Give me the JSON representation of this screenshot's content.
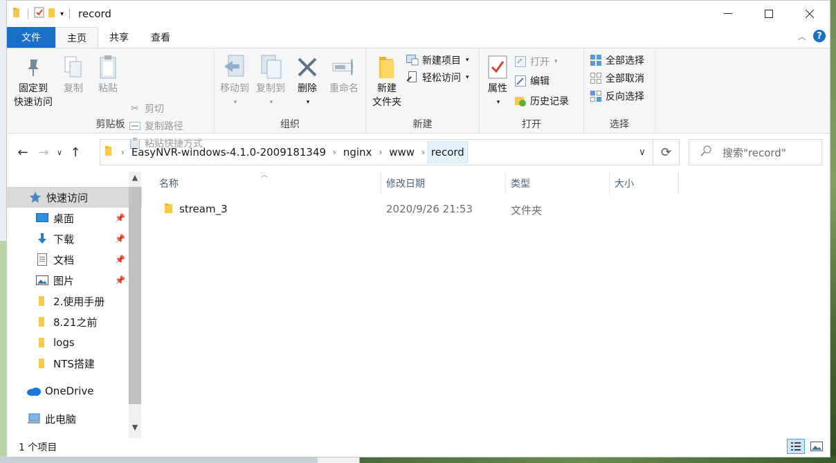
{
  "window": {
    "title": "record"
  },
  "tabs": [
    {
      "label": "文件"
    },
    {
      "label": "主页"
    },
    {
      "label": "共享"
    },
    {
      "label": "查看"
    }
  ],
  "ribbon": {
    "clipboard": {
      "label": "剪贴板",
      "pin_line1": "固定到",
      "pin_line2": "快速访问",
      "copy": "复制",
      "paste": "粘贴",
      "cut": "剪切",
      "copy_path": "复制路径",
      "paste_shortcut": "粘贴快捷方式"
    },
    "organize": {
      "label": "组织",
      "move_to": "移动到",
      "copy_to": "复制到",
      "delete": "删除",
      "rename": "重命名"
    },
    "new": {
      "label": "新建",
      "new_folder_line1": "新建",
      "new_folder_line2": "文件夹",
      "new_item": "新建项目",
      "easy_access": "轻松访问"
    },
    "open": {
      "label": "打开",
      "properties": "属性",
      "open": "打开",
      "edit": "编辑",
      "history": "历史记录"
    },
    "select": {
      "label": "选择",
      "select_all": "全部选择",
      "select_none": "全部取消",
      "invert": "反向选择"
    }
  },
  "address": {
    "crumbs": [
      "EasyNVR-windows-4.1.0-2009181349",
      "nginx",
      "www",
      "record"
    ],
    "search_placeholder": "搜索\"record\""
  },
  "nav": {
    "quick_access": "快速访问",
    "items": [
      {
        "label": "桌面",
        "pinned": true
      },
      {
        "label": "下载",
        "pinned": true
      },
      {
        "label": "文档",
        "pinned": true
      },
      {
        "label": "图片",
        "pinned": true
      },
      {
        "label": "2.使用手册",
        "pinned": false
      },
      {
        "label": "8.21之前",
        "pinned": false
      },
      {
        "label": "logs",
        "pinned": false
      },
      {
        "label": "NTS搭建",
        "pinned": false
      }
    ],
    "onedrive": "OneDrive",
    "this_pc": "此电脑"
  },
  "columns": {
    "name": "名称",
    "modified": "修改日期",
    "type": "类型",
    "size": "大小"
  },
  "files": [
    {
      "name": "stream_3",
      "modified": "2020/9/26 21:53",
      "type": "文件夹",
      "size": ""
    }
  ],
  "status": {
    "count": "1 个项目"
  },
  "colors": {
    "accent": "#1a6fc7",
    "folder": "#f7c94a",
    "selection": "#d9d9d9"
  }
}
